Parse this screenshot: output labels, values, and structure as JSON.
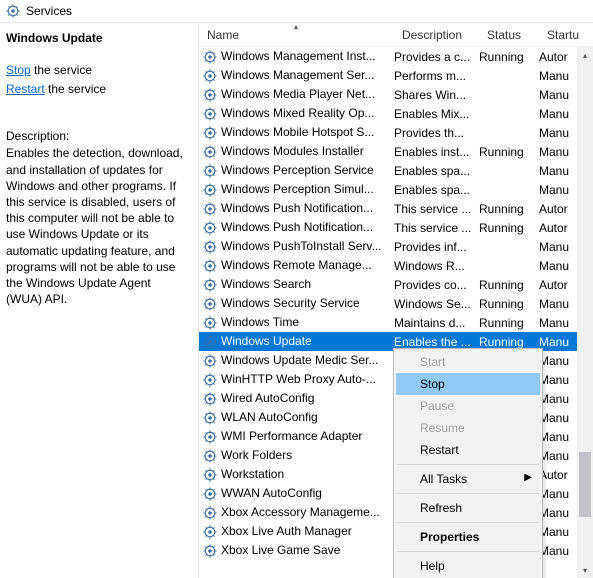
{
  "window": {
    "title": "Services"
  },
  "left": {
    "service_name": "Windows Update",
    "action_stop_link": "Stop",
    "action_stop_suffix": " the service",
    "action_restart_link": "Restart",
    "action_restart_suffix": " the service",
    "desc_label": "Description:",
    "desc_body": "Enables the detection, download, and installation of updates for Windows and other programs. If this service is disabled, users of this computer will not be able to use Windows Update or its automatic updating feature, and programs will not be able to use the Windows Update Agent (WUA) API."
  },
  "columns": {
    "name": "Name",
    "description": "Description",
    "status": "Status",
    "startup": "Startu"
  },
  "context_menu": {
    "start": "Start",
    "stop": "Stop",
    "pause": "Pause",
    "resume": "Resume",
    "restart": "Restart",
    "all_tasks": "All Tasks",
    "refresh": "Refresh",
    "properties": "Properties",
    "help": "Help"
  },
  "selected_index": 15,
  "services": [
    {
      "name": "Windows Management Inst...",
      "desc": "Provides a c...",
      "status": "Running",
      "startup": "Autor"
    },
    {
      "name": "Windows Management Ser...",
      "desc": "Performs m...",
      "status": "",
      "startup": "Manu"
    },
    {
      "name": "Windows Media Player Net...",
      "desc": "Shares Win...",
      "status": "",
      "startup": "Manu"
    },
    {
      "name": "Windows Mixed Reality Op...",
      "desc": "Enables Mix...",
      "status": "",
      "startup": "Manu"
    },
    {
      "name": "Windows Mobile Hotspot S...",
      "desc": "Provides th...",
      "status": "",
      "startup": "Manu"
    },
    {
      "name": "Windows Modules Installer",
      "desc": "Enables inst...",
      "status": "Running",
      "startup": "Manu"
    },
    {
      "name": "Windows Perception Service",
      "desc": "Enables spa...",
      "status": "",
      "startup": "Manu"
    },
    {
      "name": "Windows Perception Simul...",
      "desc": "Enables spa...",
      "status": "",
      "startup": "Manu"
    },
    {
      "name": "Windows Push Notification...",
      "desc": "This service ...",
      "status": "Running",
      "startup": "Autor"
    },
    {
      "name": "Windows Push Notification...",
      "desc": "This service ...",
      "status": "Running",
      "startup": "Autor"
    },
    {
      "name": "Windows PushToInstall Serv...",
      "desc": "Provides inf...",
      "status": "",
      "startup": "Manu"
    },
    {
      "name": "Windows Remote Manage...",
      "desc": "Windows R...",
      "status": "",
      "startup": "Manu"
    },
    {
      "name": "Windows Search",
      "desc": "Provides co...",
      "status": "Running",
      "startup": "Autor"
    },
    {
      "name": "Windows Security Service",
      "desc": "Windows Se...",
      "status": "Running",
      "startup": "Manu"
    },
    {
      "name": "Windows Time",
      "desc": "Maintains d...",
      "status": "Running",
      "startup": "Manu"
    },
    {
      "name": "Windows Update",
      "desc": "Enables the ...",
      "status": "Running",
      "startup": "Manu"
    },
    {
      "name": "Windows Update Medic Ser...",
      "desc": "",
      "status": "",
      "startup": "Manu"
    },
    {
      "name": "WinHTTP Web Proxy Auto-...",
      "desc": "",
      "status": "",
      "startup": "Manu"
    },
    {
      "name": "Wired AutoConfig",
      "desc": "",
      "status": "",
      "startup": "Manu"
    },
    {
      "name": "WLAN AutoConfig",
      "desc": "",
      "status": "",
      "startup": "Manu"
    },
    {
      "name": "WMI Performance Adapter",
      "desc": "",
      "status": "",
      "startup": "Manu"
    },
    {
      "name": "Work Folders",
      "desc": "",
      "status": "",
      "startup": "Manu"
    },
    {
      "name": "Workstation",
      "desc": "",
      "status": "",
      "startup": "Autor"
    },
    {
      "name": "WWAN AutoConfig",
      "desc": "",
      "status": "",
      "startup": "Manu"
    },
    {
      "name": "Xbox Accessory Manageme...",
      "desc": "",
      "status": "",
      "startup": "Manu"
    },
    {
      "name": "Xbox Live Auth Manager",
      "desc": "",
      "status": "",
      "startup": "Manu"
    },
    {
      "name": "Xbox Live Game Save",
      "desc": "",
      "status": "",
      "startup": "Manu"
    }
  ]
}
